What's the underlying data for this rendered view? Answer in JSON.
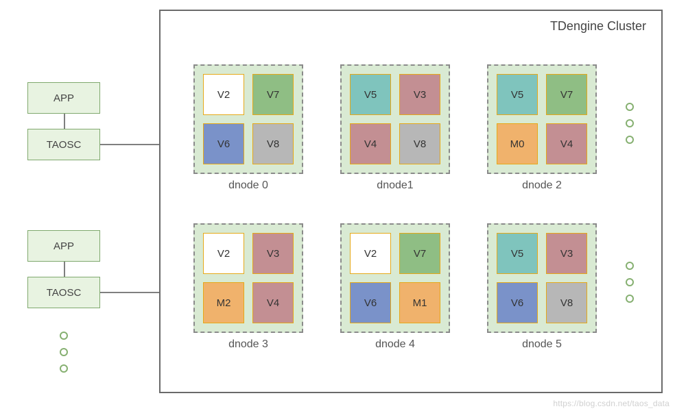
{
  "cluster_title": "TDengine Cluster",
  "watermark": "https://blog.csdn.net/taos_data",
  "clients": [
    {
      "app": "APP",
      "taosc": "TAOSC"
    },
    {
      "app": "APP",
      "taosc": "TAOSC"
    }
  ],
  "dnodes": [
    {
      "label": "dnode 0",
      "cells": [
        {
          "t": "V2",
          "c": "c-white"
        },
        {
          "t": "V7",
          "c": "c-green"
        },
        {
          "t": "V6",
          "c": "c-blue"
        },
        {
          "t": "V8",
          "c": "c-grey"
        }
      ]
    },
    {
      "label": "dnode1",
      "cells": [
        {
          "t": "V5",
          "c": "c-teal"
        },
        {
          "t": "V3",
          "c": "c-mauve"
        },
        {
          "t": "V4",
          "c": "c-mauve"
        },
        {
          "t": "V8",
          "c": "c-grey"
        }
      ]
    },
    {
      "label": "dnode 2",
      "cells": [
        {
          "t": "V5",
          "c": "c-teal"
        },
        {
          "t": "V7",
          "c": "c-green"
        },
        {
          "t": "M0",
          "c": "c-orange"
        },
        {
          "t": "V4",
          "c": "c-mauve"
        }
      ]
    },
    {
      "label": "dnode 3",
      "cells": [
        {
          "t": "V2",
          "c": "c-white"
        },
        {
          "t": "V3",
          "c": "c-mauve"
        },
        {
          "t": "M2",
          "c": "c-orange"
        },
        {
          "t": "V4",
          "c": "c-mauve"
        }
      ]
    },
    {
      "label": "dnode 4",
      "cells": [
        {
          "t": "V2",
          "c": "c-white"
        },
        {
          "t": "V7",
          "c": "c-green"
        },
        {
          "t": "V6",
          "c": "c-blue"
        },
        {
          "t": "M1",
          "c": "c-orange"
        }
      ]
    },
    {
      "label": "dnode 5",
      "cells": [
        {
          "t": "V5",
          "c": "c-teal"
        },
        {
          "t": "V3",
          "c": "c-mauve"
        },
        {
          "t": "V6",
          "c": "c-blue"
        },
        {
          "t": "V8",
          "c": "c-grey"
        }
      ]
    }
  ]
}
